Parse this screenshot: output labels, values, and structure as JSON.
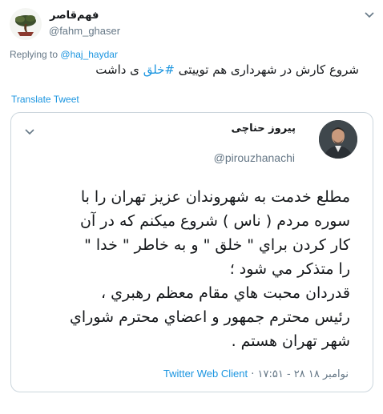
{
  "tweet": {
    "display_name": "فهم‌قاصر",
    "handle": "@fahm_ghaser",
    "replying_prefix": "Replying to",
    "replying_to": "@haj_haydar",
    "text_before": "شروع کارش در شهرداری هم توییتی ",
    "hashtag": "#خلق",
    "text_after": " ی داشت",
    "translate_label": "Translate Tweet"
  },
  "quoted": {
    "display_name": "پیروز حناچی",
    "handle": "@pirouzhanachi",
    "lines": [
      "مطلع خدمت به شهروندان عزيز تهران را با",
      "سوره مردم ( ناس ) شروع ميكنم كه در آن",
      "كار كردن براي \" خلق \" و به خاطر \" خدا \"",
      "را متذكر مي شود ؛",
      "قدردان محبت هاي مقام معظم رهبري ،",
      "رئيس محترم جمهور و اعضاي محترم شوراي",
      "شهر تهران هستم ."
    ],
    "timestamp": "۱۷:۵۱ - ۲۸ نوامبر ۱۸",
    "separator": " · ",
    "client": "Twitter Web Client"
  },
  "colors": {
    "link": "#1b95e0",
    "muted": "#657786",
    "text": "#14171a",
    "border": "#ccd6dd"
  },
  "icons": {
    "avatar": "bonsai-tree-avatar",
    "menu": "chevron-down-icon",
    "quoted_avatar": "portrait-avatar"
  }
}
